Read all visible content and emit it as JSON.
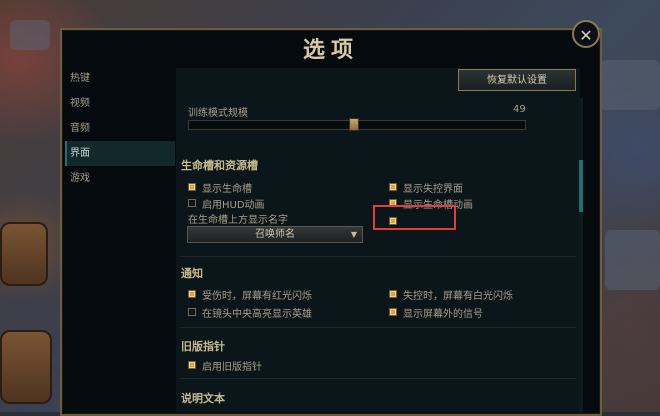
{
  "dialog": {
    "title": "选项",
    "close_glyph": "✕"
  },
  "sidebar": {
    "items": [
      {
        "label": "热键",
        "active": false
      },
      {
        "label": "视频",
        "active": false
      },
      {
        "label": "音频",
        "active": false
      },
      {
        "label": "界面",
        "active": true
      },
      {
        "label": "游戏",
        "active": false
      }
    ]
  },
  "toolbar": {
    "reset_label": "恢复默认设置"
  },
  "training_scale": {
    "label": "训练模式规模",
    "value": "49",
    "level": 0.49
  },
  "health_section": {
    "title": "生命槽和资源槽",
    "options": {
      "show_health": {
        "label": "显示生命槽",
        "checked": true
      },
      "show_control_ui": {
        "label": "显示失控界面",
        "checked": true
      },
      "hud_animation": {
        "label": "启用HUD动画",
        "checked": false
      },
      "health_animation": {
        "label": "显示生命槽动画",
        "checked": true
      },
      "name_checkbox": {
        "checked": true
      }
    },
    "name_label": "在生命槽上方显示名字",
    "name_dropdown": {
      "selected": "召唤师名"
    }
  },
  "notify_section": {
    "title": "通知",
    "options": {
      "hurt_flash": {
        "label": "受伤时，屏幕有红光闪烁",
        "checked": true
      },
      "cc_flash": {
        "label": "失控时，屏幕有白光闪烁",
        "checked": true
      },
      "highlight_hero": {
        "label": "在镜头中央高亮显示英雄",
        "checked": false
      },
      "offscreen_signals": {
        "label": "显示屏幕外的信号",
        "checked": true
      }
    }
  },
  "legacy_section": {
    "title": "旧版指针",
    "options": {
      "legacy_cursor": {
        "label": "启用旧版指针",
        "checked": true
      }
    }
  },
  "desc_section": {
    "title": "说明文本"
  },
  "colors": {
    "accent_gold": "#c7b98f",
    "highlight_red": "#e0403a",
    "teal": "#1f6f73"
  }
}
